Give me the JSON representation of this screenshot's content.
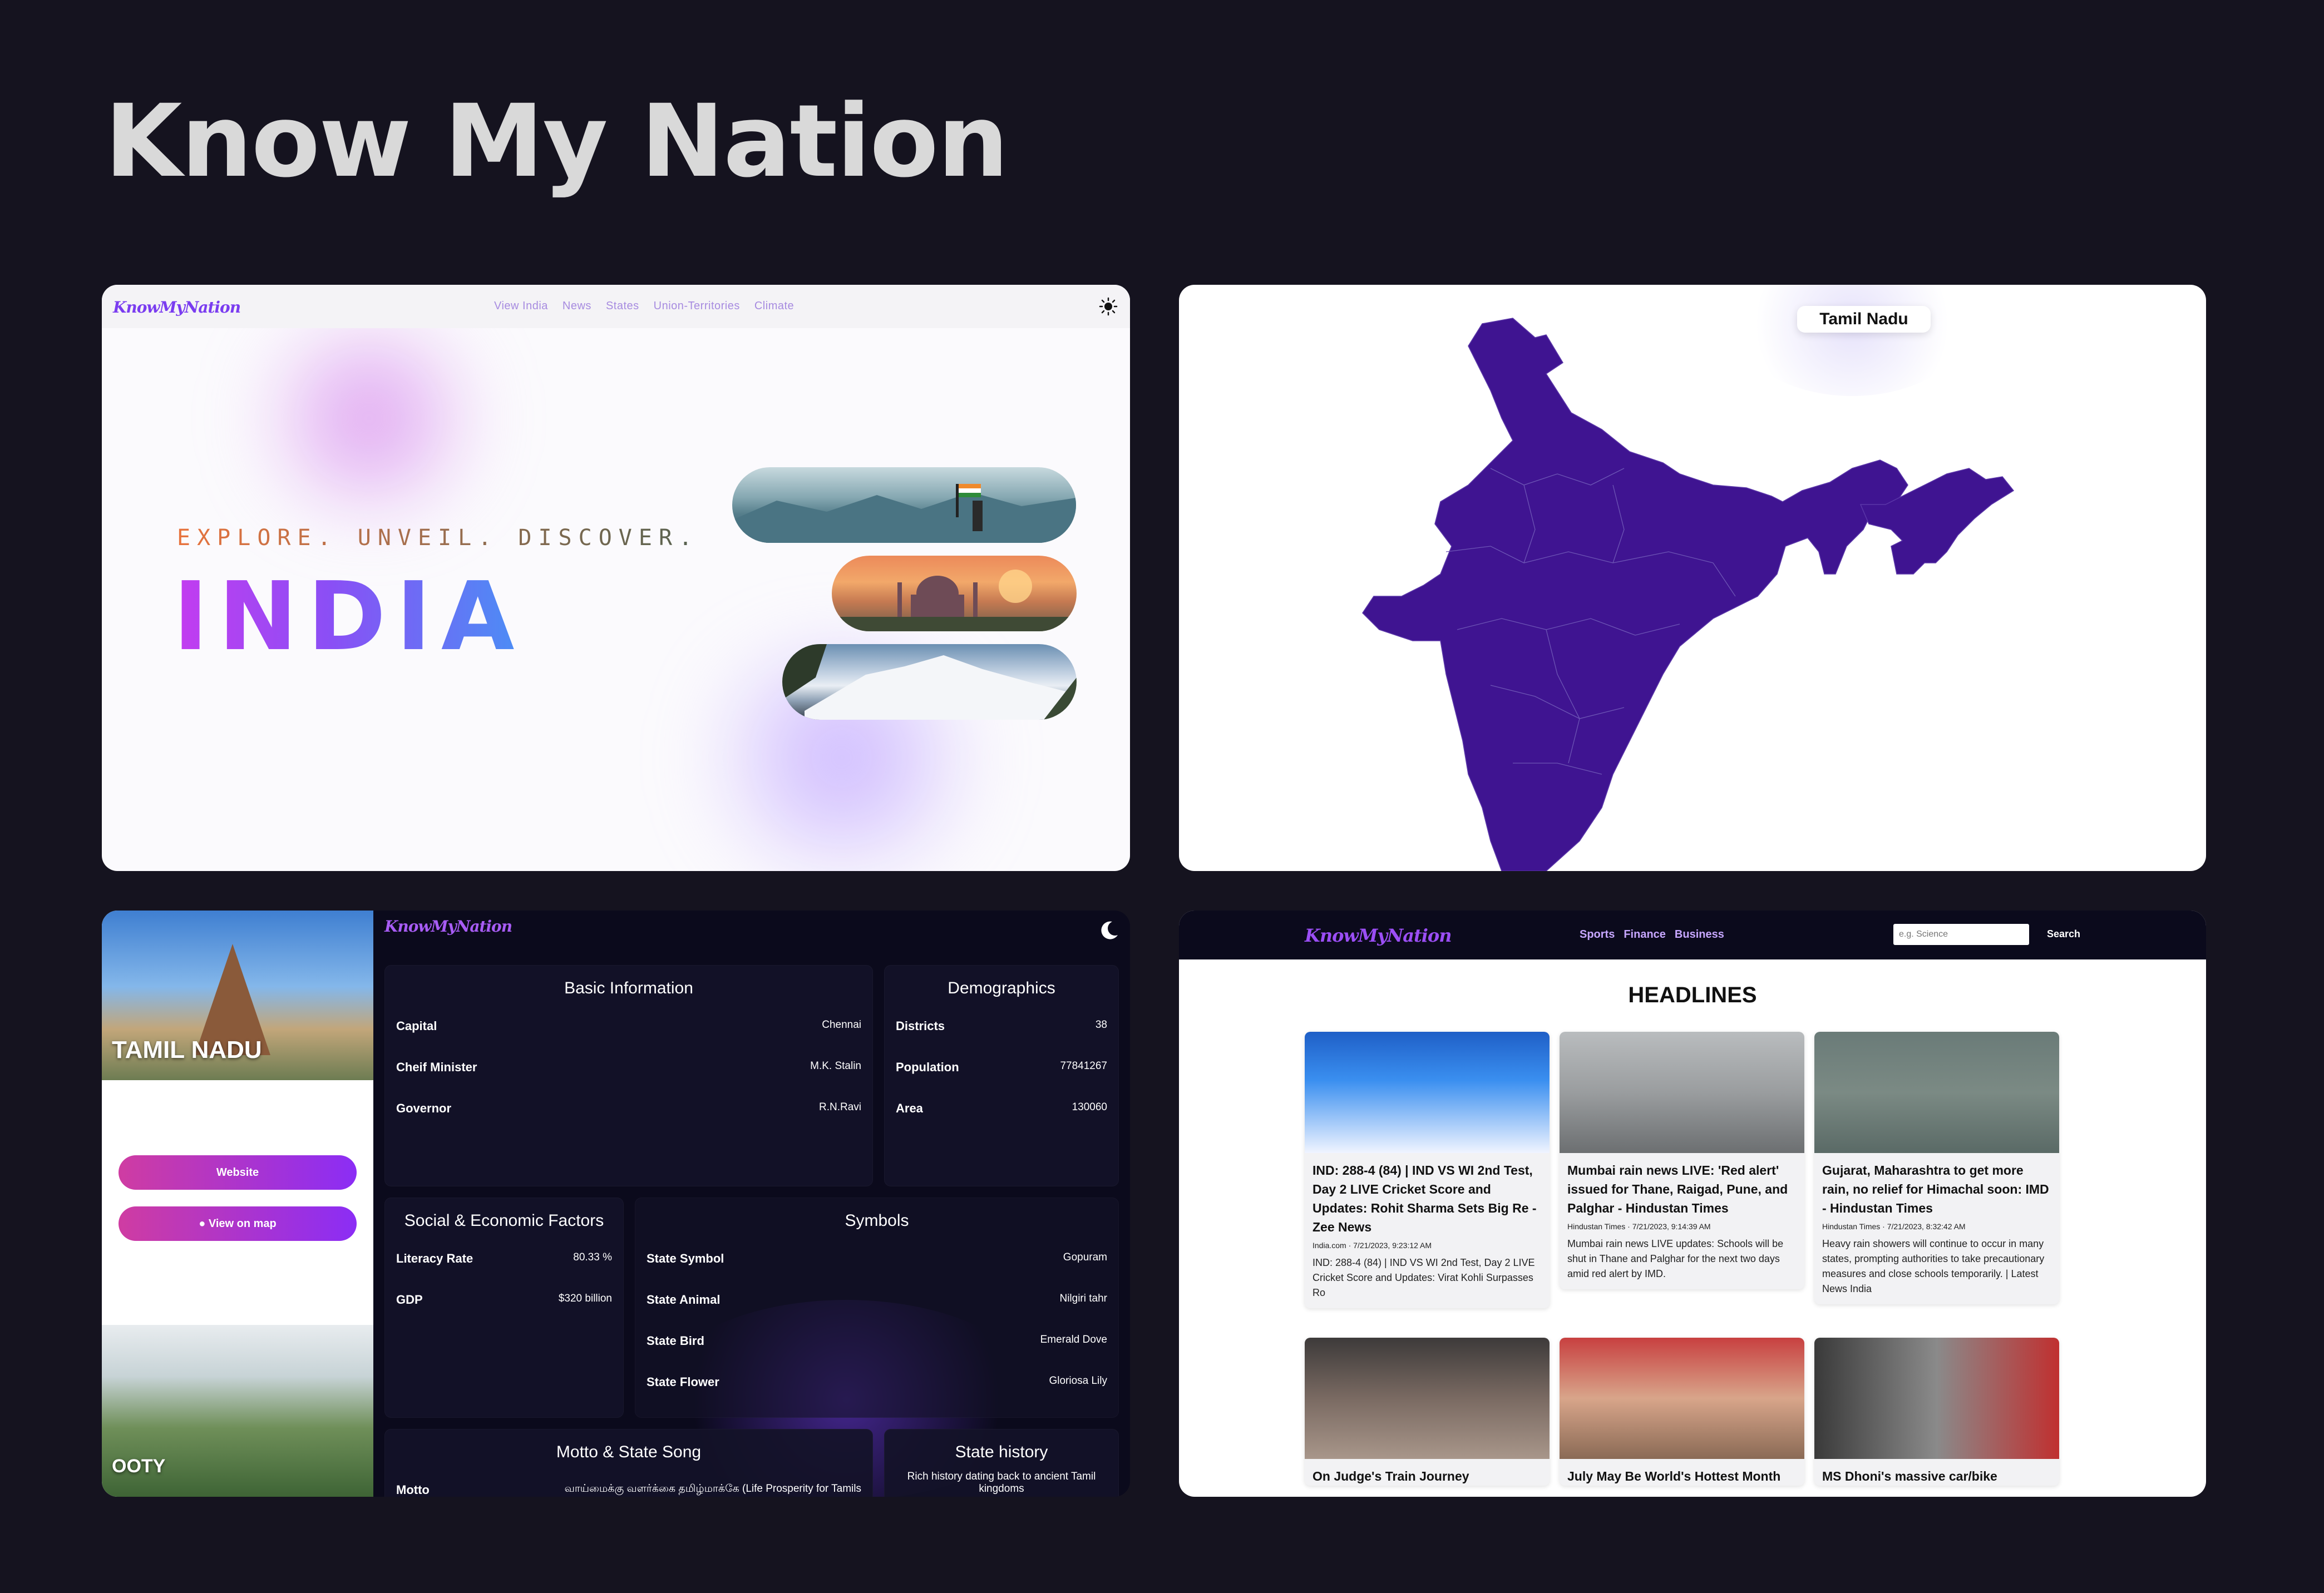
{
  "title": "Know My Nation",
  "hero": {
    "logo": "KnowMyNation",
    "nav": [
      "View India",
      "News",
      "States",
      "Union-Territories",
      "Climate"
    ],
    "tagline": "EXPLORE. UNVEIL. DISCOVER.",
    "headline": "INDIA",
    "colors": {
      "accent": "#8a4ff5",
      "gradient_start": "#c43cf0",
      "gradient_end": "#4a8ff5"
    }
  },
  "map": {
    "tooltip": "Tamil Nadu",
    "fill_color": "#3f1491"
  },
  "state": {
    "logo": "KnowMyNation",
    "name": "TAMIL NADU",
    "website_label": "Website",
    "map_label": "View on map",
    "place": "OOTY",
    "basic": {
      "heading": "Basic Information",
      "rows": [
        {
          "k": "Capital",
          "v": "Chennai"
        },
        {
          "k": "Cheif Minister",
          "v": "M.K. Stalin"
        },
        {
          "k": "Governor",
          "v": "R.N.Ravi"
        }
      ]
    },
    "demographics": {
      "heading": "Demographics",
      "rows": [
        {
          "k": "Districts",
          "v": "38"
        },
        {
          "k": "Population",
          "v": "77841267"
        },
        {
          "k": "Area",
          "v": "130060"
        }
      ]
    },
    "social": {
      "heading": "Social & Economic Factors",
      "rows": [
        {
          "k": "Literacy Rate",
          "v": "80.33 %"
        },
        {
          "k": "GDP",
          "v": "$320 billion"
        }
      ]
    },
    "symbols": {
      "heading": "Symbols",
      "rows": [
        {
          "k": "State Symbol",
          "v": "Gopuram"
        },
        {
          "k": "State Animal",
          "v": "Nilgiri tahr"
        },
        {
          "k": "State Bird",
          "v": "Emerald Dove"
        },
        {
          "k": "State Flower",
          "v": "Gloriosa Lily"
        }
      ]
    },
    "motto": {
      "heading": "Motto & State Song",
      "rows": [
        {
          "k": "Motto",
          "v": "வாய்மைக்கு வளர்க்கை தமிழ்மாக்கே (Life Prosperity for Tamils"
        }
      ]
    },
    "history": {
      "heading": "State history",
      "text": "Rich history dating back to ancient Tamil kingdoms"
    }
  },
  "news": {
    "logo": "KnowMyNation",
    "nav": [
      "Sports",
      "Finance",
      "Business"
    ],
    "search_placeholder": "e.g. Science",
    "search_label": "Search",
    "heading": "HEADLINES",
    "articles": [
      {
        "title": "IND: 288-4 (84) | IND VS WI 2nd Test, Day 2 LIVE Cricket Score and Updates: Rohit Sharma Sets Big Re - Zee News",
        "meta": "India.com · 7/21/2023, 9:23:12 AM",
        "desc": "IND: 288-4 (84) | IND VS WI 2nd Test, Day 2 LIVE Cricket Score and Updates: Virat Kohli Surpasses Ro"
      },
      {
        "title": "Mumbai rain news LIVE: 'Red alert' issued for Thane, Raigad, Pune, and Palghar - Hindustan Times",
        "meta": "Hindustan Times · 7/21/2023, 9:14:39 AM",
        "desc": "Mumbai rain news LIVE updates: Schools will be shut in Thane and Palghar for the next two days amid red alert by IMD."
      },
      {
        "title": "Gujarat, Maharashtra to get more rain, no relief for Himachal soon: IMD - Hindustan Times",
        "meta": "Hindustan Times · 7/21/2023, 8:32:42 AM",
        "desc": "Heavy rain showers will continue to occur in many states, prompting authorities to take precautionary measures and close schools temporarily. | Latest News India"
      },
      {
        "title": "On Judge's Train Journey",
        "meta": "",
        "desc": ""
      },
      {
        "title": "July May Be World's Hottest Month",
        "meta": "",
        "desc": ""
      },
      {
        "title": "MS Dhoni's massive car/bike",
        "meta": "",
        "desc": ""
      }
    ]
  }
}
